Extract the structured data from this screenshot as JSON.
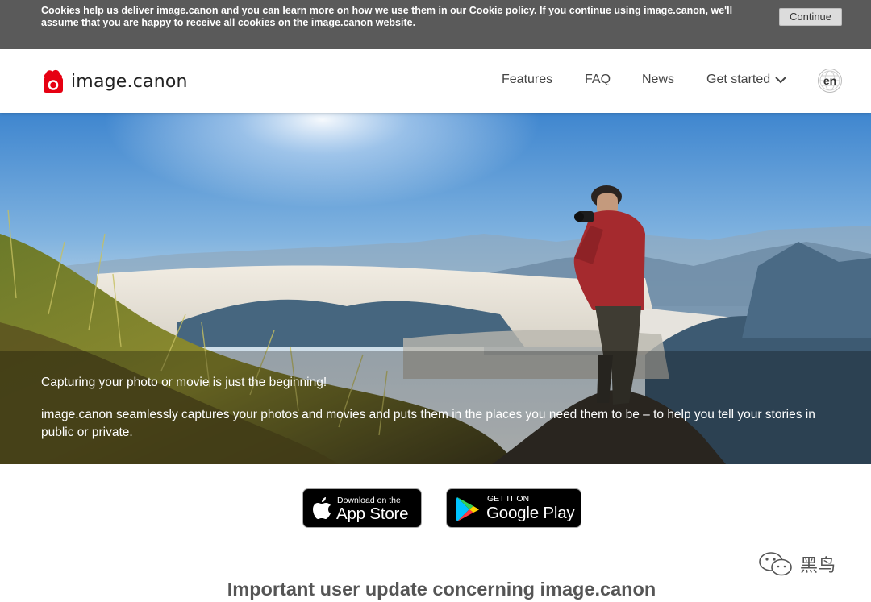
{
  "cookie_bar": {
    "text_before": "Cookies help us deliver image.canon and you can learn more on how we use them in our ",
    "link_label": "Cookie policy",
    "text_after": ". If you continue using image.canon, we'll assume that you are happy to receive all cookies on the image.canon website.",
    "continue_label": "Continue"
  },
  "header": {
    "logo_text": "image.canon",
    "nav": {
      "features": "Features",
      "faq": "FAQ",
      "news": "News",
      "get_started": "Get started"
    },
    "language": "en"
  },
  "hero": {
    "tagline": "Capturing your photo or movie is just the beginning!",
    "description": "image.canon seamlessly captures your photos and movies and puts them in the places you need them to be – to help you tell your stories in public or private."
  },
  "badges": {
    "app_store_small": "Download on the",
    "app_store_big": "App Store",
    "google_small": "GET IT ON",
    "google_big": "Google Play"
  },
  "update_title": "Important user update concerning image.canon",
  "watermark": {
    "text": "黑鸟"
  },
  "colors": {
    "brand_red": "#e60012",
    "cookie_bar_bg": "#5a5a5a"
  }
}
